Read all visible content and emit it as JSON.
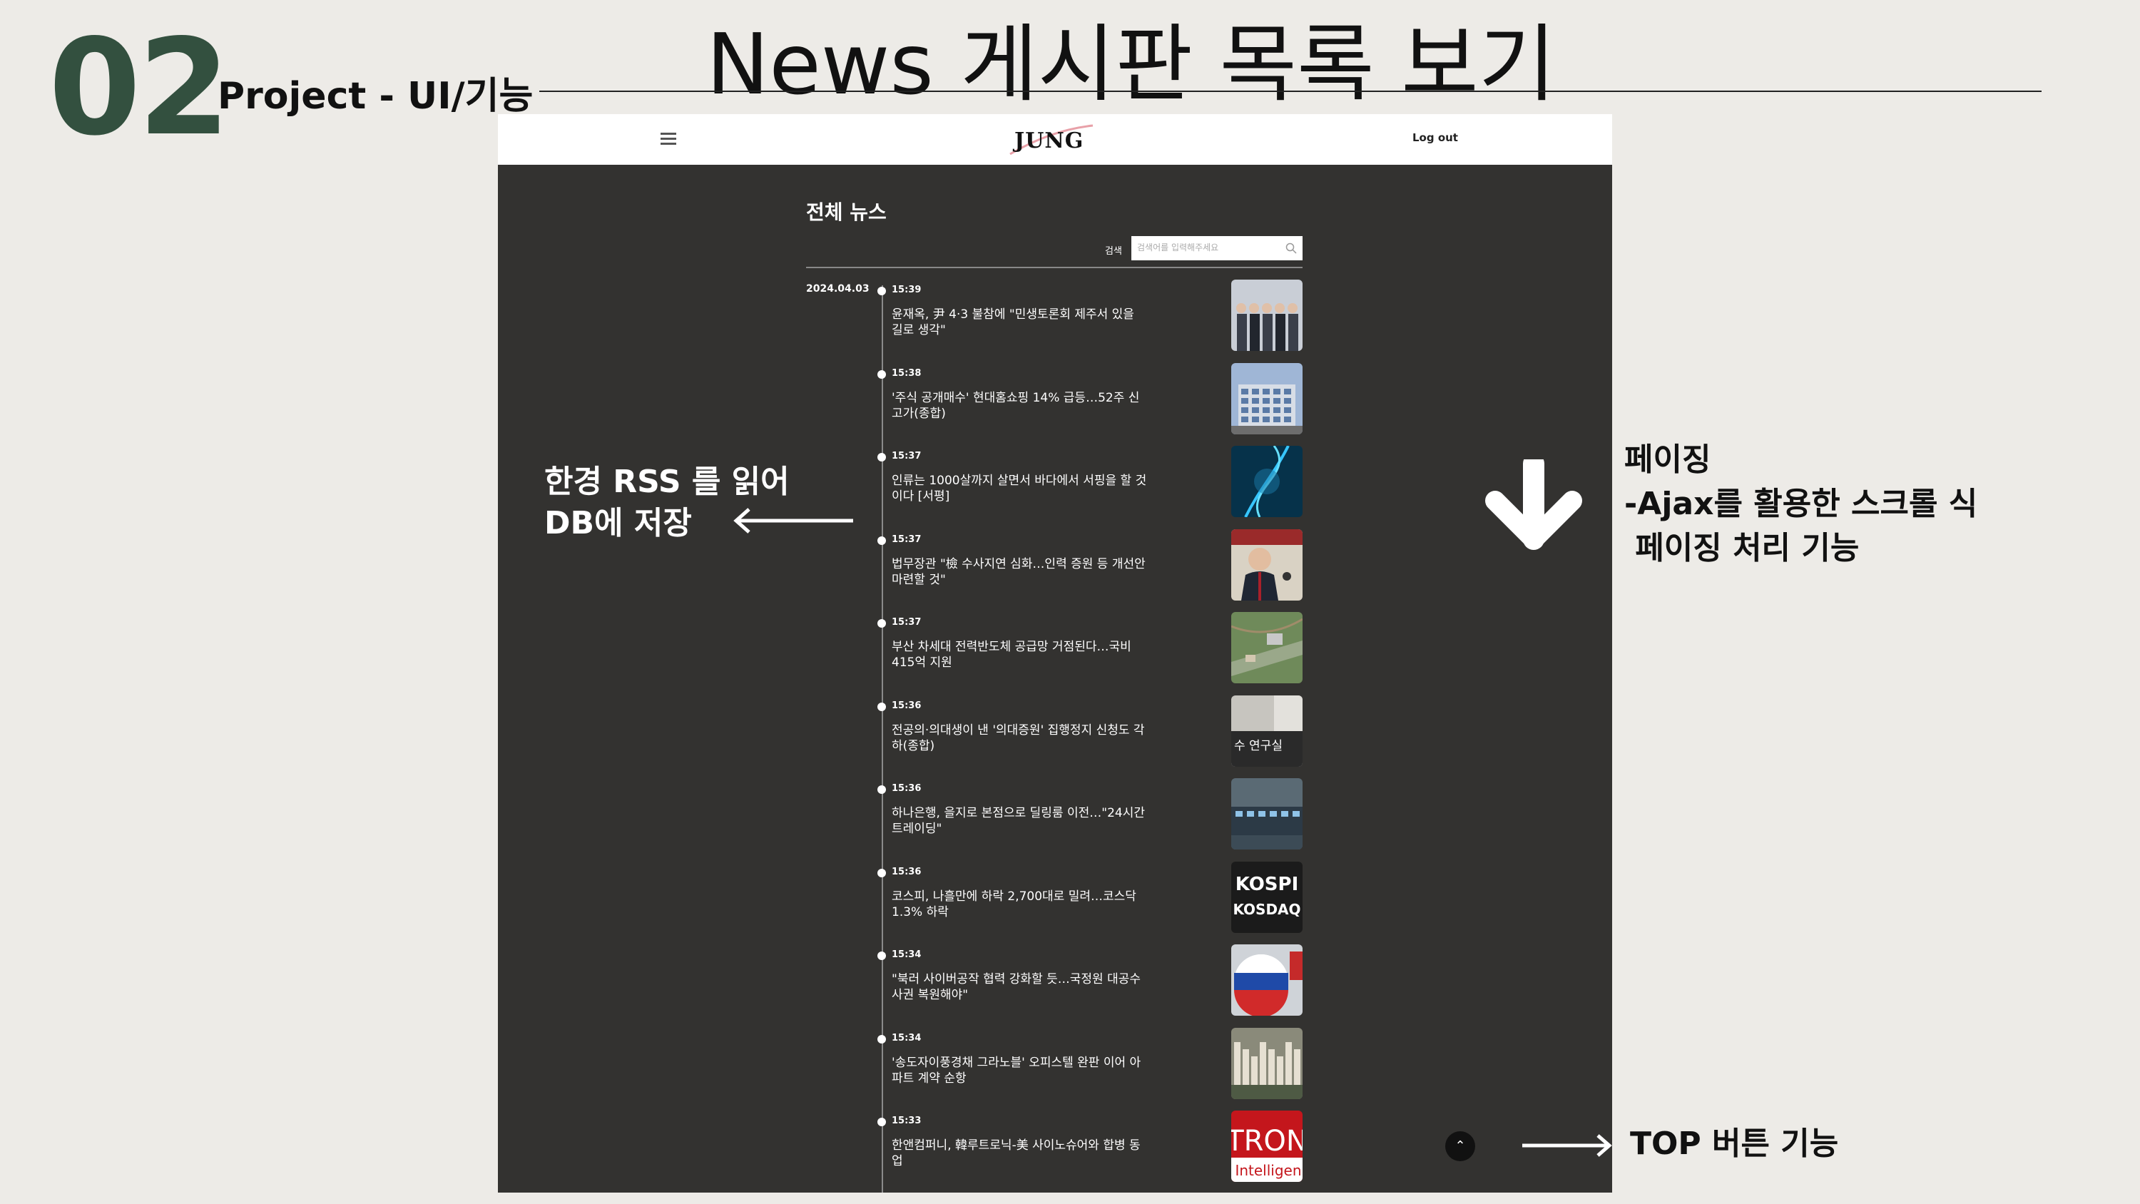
{
  "slide": {
    "number": "02",
    "section": "Project - UI/기능",
    "title": "News 게시판 목록 보기"
  },
  "app": {
    "logo": "JUNG",
    "logout_label": "Log out",
    "page_title": "전체 뉴스",
    "search": {
      "label": "검색",
      "placeholder": "검색어를 입력해주세요"
    },
    "date": "2024.04.03",
    "news": [
      {
        "time": "15:39",
        "headline": "윤재옥, 尹 4·3 불참에 \"민생토론회 제주서 있을 길로 생각\"",
        "thumb": "people"
      },
      {
        "time": "15:38",
        "headline": "'주식 공개매수' 현대홈쇼핑 14% 급등…52주 신고가(종합)",
        "thumb": "building"
      },
      {
        "time": "15:37",
        "headline": "인류는 1000살까지 살면서 바다에서 서핑을 할 것이다 [서평]",
        "thumb": "dna"
      },
      {
        "time": "15:37",
        "headline": "법무장관 \"檢 수사지연 심화…인력 증원 등 개선안 마련할 것\"",
        "thumb": "speaker"
      },
      {
        "time": "15:37",
        "headline": "부산 차세대 전력반도체 공급망 거점된다…국비 415억 지원",
        "thumb": "aerial"
      },
      {
        "time": "15:36",
        "headline": "전공의·의대생이 낸 '의대증원' 집행정지 신청도 각하(종합)",
        "thumb": "office"
      },
      {
        "time": "15:36",
        "headline": "하나은행, 을지로 본점으로 딜링룸 이전…\"24시간 트레이딩\"",
        "thumb": "hall"
      },
      {
        "time": "15:36",
        "headline": "코스피, 나흘만에 하락 2,700대로 밀려…코스닥 1.3% 하락",
        "thumb": "kospi"
      },
      {
        "time": "15:34",
        "headline": "\"북러 사이버공작 협력 강화할 듯…국정원 대공수사권 복원해야\"",
        "thumb": "flag"
      },
      {
        "time": "15:34",
        "headline": "'송도자이풍경채 그라노블' 오피스텔 완판 이어 아파트 계약 순항",
        "thumb": "city"
      },
      {
        "time": "15:33",
        "headline": "한앤컴퍼니, 韓루트로닉-美 사이노슈어와 합병 동업",
        "thumb": "tron"
      }
    ],
    "kospi_thumb": {
      "top": "KOSPI",
      "bottom": "KOSDAQ"
    },
    "tron_thumb": {
      "top": "TRON",
      "bottom": "Intelligen"
    },
    "office_thumb_text": "수 연구실",
    "top_button_symbol": "⌃"
  },
  "annotations": {
    "rss_note": [
      "한경 RSS 를 읽어",
      "DB에 저장"
    ],
    "paging_note": [
      "페이징",
      "-Ajax를 활용한 스크롤 식",
      " 페이징 처리 기능"
    ],
    "top_note": "TOP 버튼 기능"
  },
  "colors": {
    "accent_green": "#33503f",
    "panel_bg": "#333230",
    "slide_bg": "#edebe7"
  }
}
